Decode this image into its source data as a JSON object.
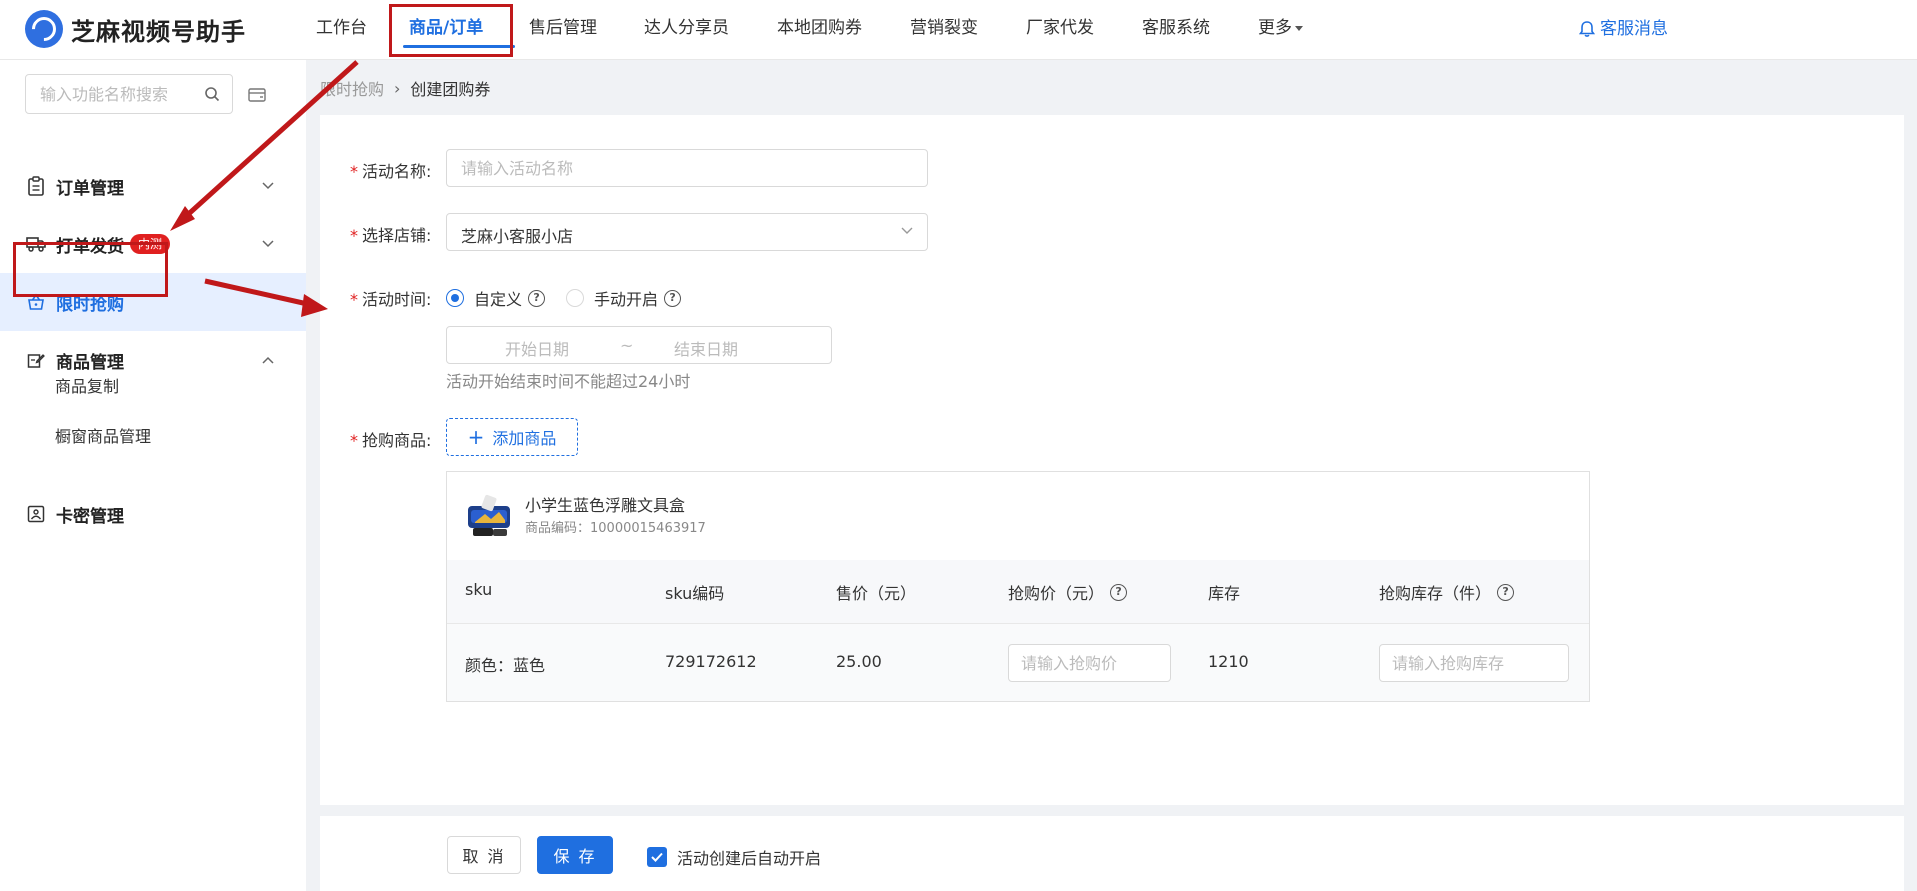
{
  "app": {
    "name": "芝麻视频号助手"
  },
  "topnav": {
    "items": [
      {
        "label": "工作台"
      },
      {
        "label": "商品/订单",
        "active": true
      },
      {
        "label": "售后管理"
      },
      {
        "label": "达人分享员"
      },
      {
        "label": "本地团购券"
      },
      {
        "label": "营销裂变"
      },
      {
        "label": "厂家代发"
      },
      {
        "label": "客服系统"
      },
      {
        "label": "更多"
      }
    ],
    "message_label": "客服消息"
  },
  "sidebar": {
    "search_placeholder": "输入功能名称搜索",
    "items": [
      {
        "label": "订单管理",
        "icon": "clipboard-icon"
      },
      {
        "label": "打单发货",
        "icon": "truck-icon",
        "badge": "内测"
      },
      {
        "label": "限时抢购",
        "icon": "basket-icon",
        "active": true
      },
      {
        "label": "商品管理",
        "icon": "goods-edit-icon",
        "expanded": true
      },
      {
        "label": "卡密管理",
        "icon": "card-icon"
      }
    ],
    "sub_items": [
      {
        "label": "商品复制"
      },
      {
        "label": "橱窗商品管理"
      }
    ]
  },
  "breadcrumb": {
    "parent": "限时抢购",
    "current": "创建团购券"
  },
  "form": {
    "name_label": "活动名称:",
    "name_placeholder": "请输入活动名称",
    "shop_label": "选择店铺:",
    "shop_value": "芝麻小客服小店",
    "time_label": "活动时间:",
    "time_options": [
      {
        "label": "自定义",
        "selected": true
      },
      {
        "label": "手动开启",
        "selected": false
      }
    ],
    "start_placeholder": "开始日期",
    "range_sep": "~",
    "end_placeholder": "结束日期",
    "time_hint": "活动开始结束时间不能超过24小时",
    "goods_label": "抢购商品:",
    "add_goods": "添加商品"
  },
  "product": {
    "title": "小学生蓝色浮雕文具盒",
    "code_text": "商品编码：10000015463917",
    "columns": [
      "sku",
      "sku编码",
      "售价（元）",
      "抢购价（元）",
      "库存",
      "抢购库存（件）"
    ],
    "rows": [
      {
        "sku": "颜色：蓝色",
        "sku_code": "729172612",
        "price": "25.00",
        "flash_price_placeholder": "请输入抢购价",
        "stock": "1210",
        "flash_stock_placeholder": "请输入抢购库存"
      }
    ]
  },
  "footer": {
    "cancel": "取 消",
    "save": "保 存",
    "auto_start_label": "活动创建后自动开启",
    "auto_start_checked": true
  },
  "colors": {
    "accent": "#1f6fe0",
    "annotation": "#c0181a",
    "badge": "#e02020"
  }
}
